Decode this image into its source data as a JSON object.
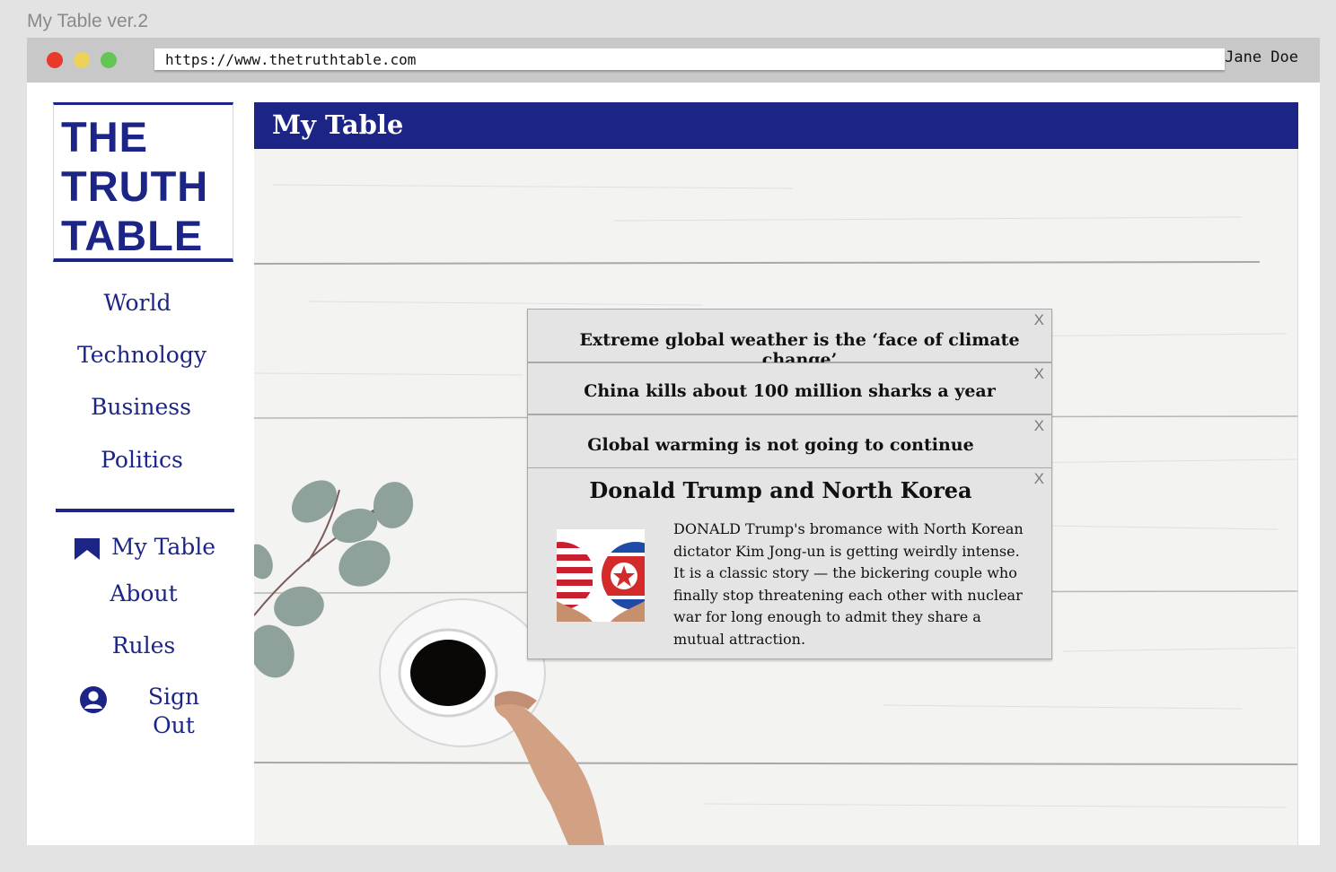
{
  "app": {
    "title": "My Table ver.2"
  },
  "browser": {
    "url": "https://www.thetruthtable.com",
    "user": "Jane Doe",
    "colors": {
      "close": "#e8392b",
      "minimize": "#ecd15a",
      "maximize": "#62c554"
    }
  },
  "logo": {
    "lines": [
      "THE",
      "TRUTH",
      "TABLE"
    ]
  },
  "nav": {
    "sections": [
      "World",
      "Technology",
      "Business",
      "Politics"
    ],
    "account": {
      "my_table": "My Table",
      "about": "About",
      "rules": "Rules",
      "sign_out": "Sign Out"
    },
    "icons": {
      "my_table": "bookmark-icon",
      "sign_out": "user-icon"
    }
  },
  "page": {
    "title": "My Table",
    "accent_color": "#1c2585"
  },
  "saved_items": [
    {
      "title": "Extreme global weather is the ‘face of climate change’",
      "close": "X"
    },
    {
      "title": "China kills about 100 million sharks a year",
      "close": "X"
    },
    {
      "title": "Global warming is not going to continue",
      "close": "X"
    }
  ],
  "expanded_item": {
    "title": "Donald Trump and North Korea",
    "close": "X",
    "excerpt": "DONALD Trump's bromance with North Korean dictator Kim Jong-un is getting weirdly intense. It is a classic story — the bickering couple who finally stop threatening each other with nuclear war for long enough to admit they share a mutual attraction.",
    "image": "us-north-korea-flags"
  }
}
